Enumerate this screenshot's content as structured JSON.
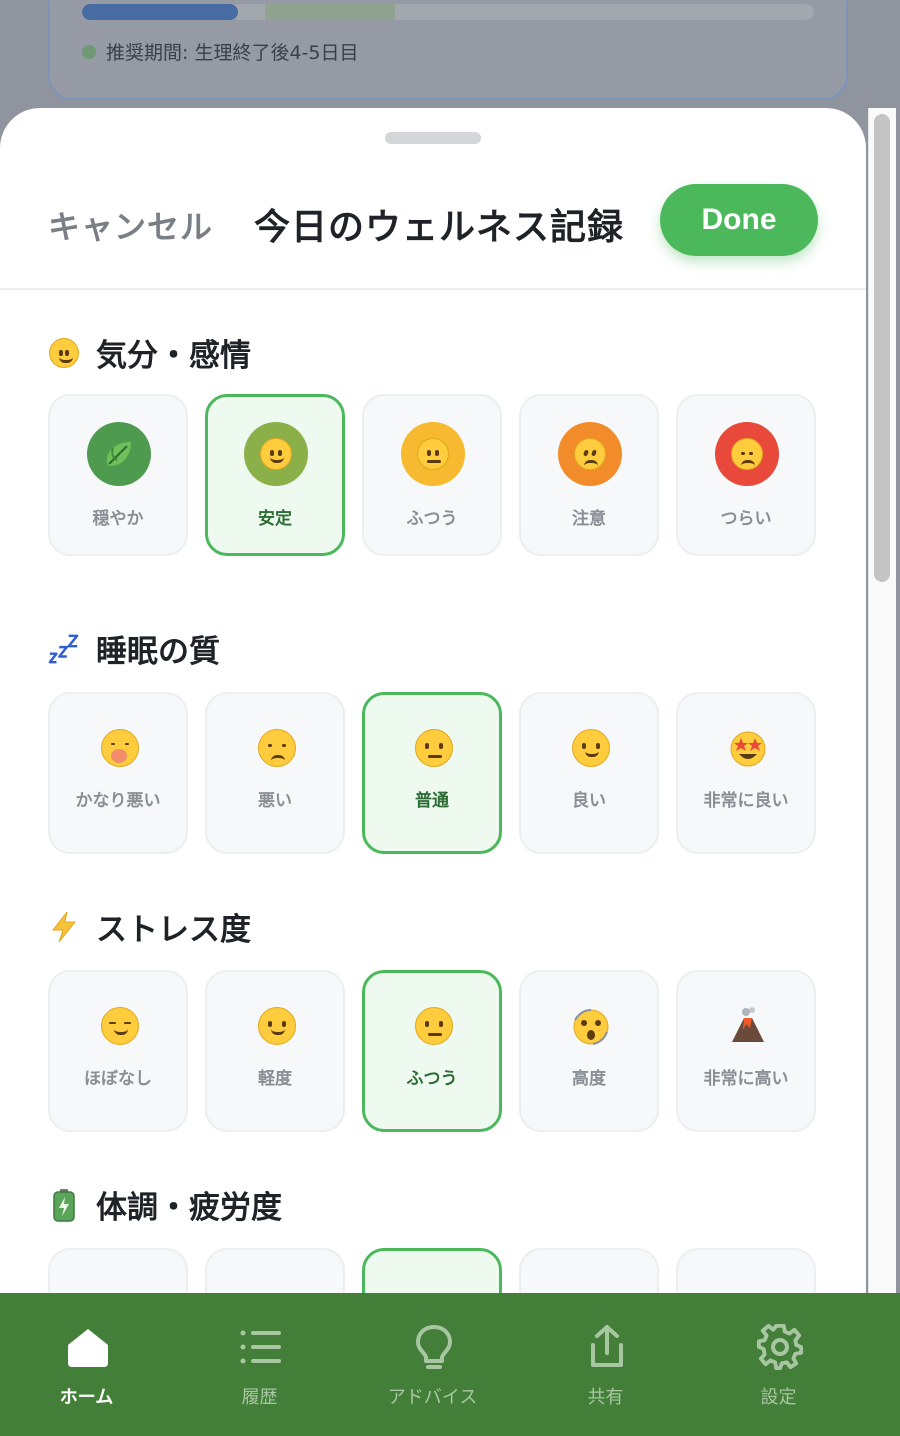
{
  "background": {
    "recommended_period": "推奨期間: 生理終了後4-5日目"
  },
  "header": {
    "cancel_label": "キャンセル",
    "title": "今日のウェルネス記録",
    "done_label": "Done"
  },
  "sections": [
    {
      "title": "気分・感情",
      "icon": "smiling-face-icon",
      "options": [
        {
          "label": "穏やか",
          "icon": "leaf-icon",
          "color": "#4e9a4f",
          "selected": false
        },
        {
          "label": "安定",
          "icon": "slight-smile-icon",
          "color": "#8bb04a",
          "selected": true
        },
        {
          "label": "ふつう",
          "icon": "neutral-face-icon",
          "color": "#f6b92f",
          "selected": false
        },
        {
          "label": "注意",
          "icon": "worried-face-icon",
          "color": "#f28c2b",
          "selected": false
        },
        {
          "label": "つらい",
          "icon": "disappointed-face-icon",
          "color": "#e8493a",
          "selected": false
        }
      ]
    },
    {
      "title": "睡眠の質",
      "icon": "zzz-icon",
      "options": [
        {
          "label": "かなり悪い",
          "icon": "yawning-face-icon",
          "selected": false
        },
        {
          "label": "悪い",
          "icon": "disappointed-face-icon",
          "selected": false
        },
        {
          "label": "普通",
          "icon": "neutral-face-icon",
          "selected": true
        },
        {
          "label": "良い",
          "icon": "slight-smile-icon",
          "selected": false
        },
        {
          "label": "非常に良い",
          "icon": "star-struck-icon",
          "selected": false
        }
      ]
    },
    {
      "title": "ストレス度",
      "icon": "lightning-icon",
      "options": [
        {
          "label": "ほぼなし",
          "icon": "relieved-face-icon",
          "selected": false
        },
        {
          "label": "軽度",
          "icon": "slight-smile-icon",
          "selected": false
        },
        {
          "label": "ふつう",
          "icon": "neutral-face-icon",
          "selected": true
        },
        {
          "label": "高度",
          "icon": "dizzy-face-icon",
          "selected": false
        },
        {
          "label": "非常に高い",
          "icon": "volcano-icon",
          "selected": false
        }
      ]
    },
    {
      "title": "体調・疲労度",
      "icon": "battery-icon",
      "options": [
        {
          "selected": false
        },
        {
          "selected": false
        },
        {
          "selected": true
        },
        {
          "selected": false
        },
        {
          "selected": false
        }
      ]
    }
  ],
  "nav": {
    "items": [
      {
        "label": "ホーム",
        "icon": "home-icon",
        "active": true
      },
      {
        "label": "履歴",
        "icon": "list-icon",
        "active": false
      },
      {
        "label": "アドバイス",
        "icon": "lightbulb-icon",
        "active": false
      },
      {
        "label": "共有",
        "icon": "share-icon",
        "active": false
      },
      {
        "label": "設定",
        "icon": "gear-icon",
        "active": false
      }
    ]
  },
  "colors": {
    "accent": "#4cb85c",
    "nav_bg": "#437f39"
  }
}
